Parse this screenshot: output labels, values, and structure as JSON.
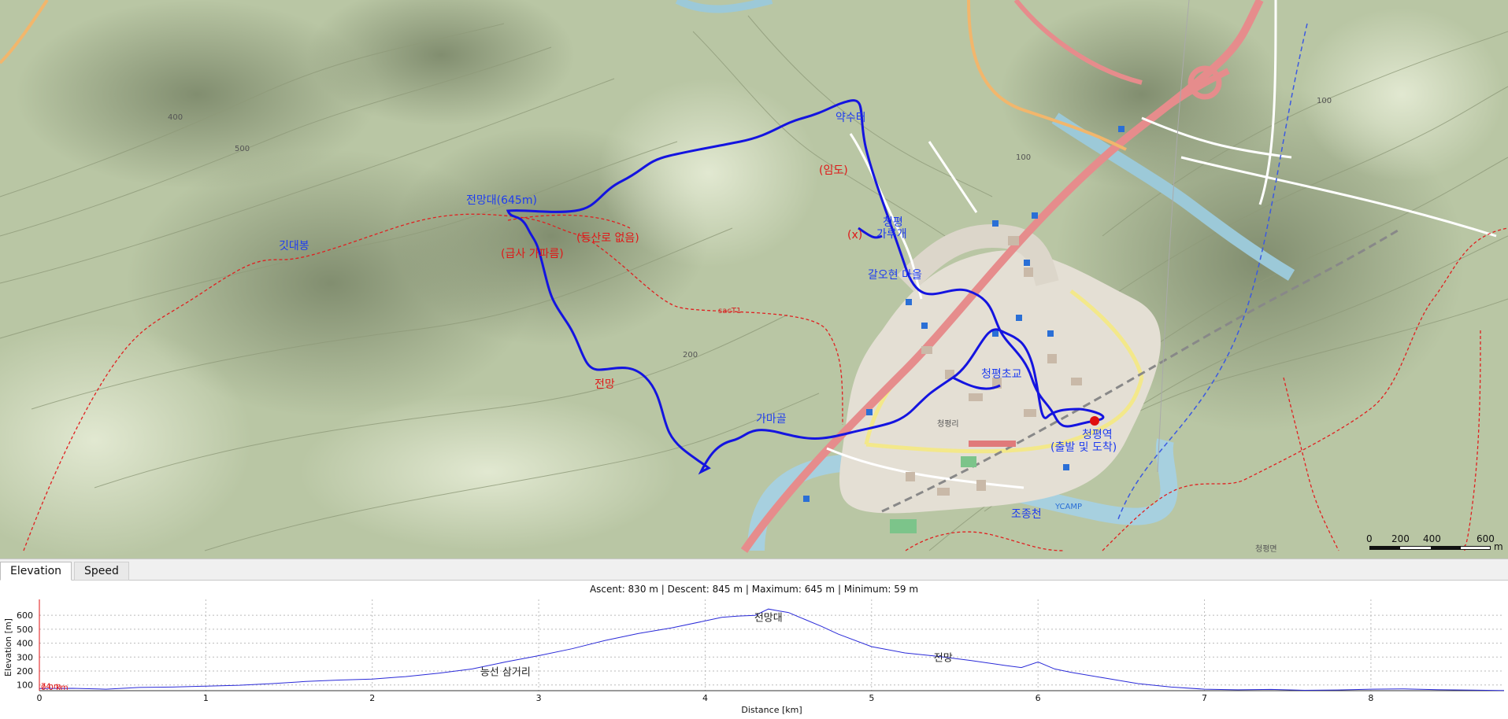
{
  "tabs": [
    {
      "label": "Elevation",
      "active": true
    },
    {
      "label": "Speed",
      "active": false
    }
  ],
  "map": {
    "route_color": "#1414e0",
    "trail_color": "#e02020",
    "labels": {
      "peak": "전망대(645m)",
      "spring": "약수터",
      "forest_road": "(임도)",
      "cheongpyeong_pass_1": "청평",
      "cheongpyeong_pass_2": "가루개",
      "x_mark": "(x)",
      "galohyeon": "갈오현 마을",
      "no_trail": "(등산로 없음)",
      "steep": "(급사 가파름)",
      "mountain": "깃대봉",
      "view": "전망",
      "gamagol": "가마골",
      "cheongpyeong_town": "청평초교",
      "station_1": "청평역",
      "station_2": "(출발 및 도착)",
      "stream": "조종천",
      "sac_label": "sacT1",
      "cheongpyeong_myeon": "청평면",
      "ycamp": "YCAMP",
      "cheongpyeongri": "청평리",
      "contour_400": "400",
      "contour_500": "500",
      "contour_200": "200",
      "contour_100a": "100",
      "contour_100b": "100"
    },
    "scale": {
      "ticks": [
        "0",
        "200",
        "400",
        "600"
      ],
      "unit": "m"
    }
  },
  "profile": {
    "stats": "Ascent: 830 m | Descent: 845 m | Maximum: 645 m | Minimum: 59 m",
    "ylabel": "Elevation [m]",
    "xlabel": "Distance [km]",
    "cursor_elevation": "74 m",
    "cursor_distance": "0.0 km",
    "annotations": {
      "junction": "능선 삼거리",
      "peak": "전망대",
      "view": "전망"
    },
    "line_color": "#2a2ad8",
    "cursor_color": "#e01010"
  },
  "chart_data": {
    "type": "line",
    "xlabel": "Distance [km]",
    "ylabel": "Elevation [m]",
    "xlim": [
      0,
      8.8
    ],
    "ylim": [
      59,
      680
    ],
    "x_ticks": [
      0,
      1,
      2,
      3,
      4,
      5,
      6,
      7,
      8
    ],
    "y_ticks": [
      100,
      200,
      300,
      400,
      500,
      600
    ],
    "grid": true,
    "series": [
      {
        "x": [
          0,
          0.2,
          0.4,
          0.6,
          0.8,
          1.0,
          1.2,
          1.4,
          1.6,
          1.8,
          2.0,
          2.2,
          2.4,
          2.6,
          2.8,
          3.0,
          3.2,
          3.4,
          3.6,
          3.8,
          4.0,
          4.1,
          4.2,
          4.3,
          4.38,
          4.45,
          4.5,
          4.6,
          4.7,
          4.8,
          5.0,
          5.2,
          5.4,
          5.6,
          5.8,
          5.9,
          6.0,
          6.1,
          6.2,
          6.4,
          6.6,
          6.8,
          7.0,
          7.2,
          7.4,
          7.6,
          7.8,
          8.0,
          8.2,
          8.4,
          8.6,
          8.8
        ],
        "y": [
          74,
          76,
          70,
          82,
          85,
          92,
          98,
          110,
          125,
          135,
          142,
          160,
          185,
          215,
          265,
          310,
          360,
          420,
          470,
          510,
          560,
          585,
          595,
          600,
          645,
          630,
          620,
          570,
          520,
          465,
          375,
          330,
          305,
          275,
          240,
          225,
          265,
          215,
          190,
          150,
          110,
          85,
          70,
          65,
          68,
          62,
          64,
          70,
          72,
          66,
          63,
          60
        ]
      }
    ]
  }
}
